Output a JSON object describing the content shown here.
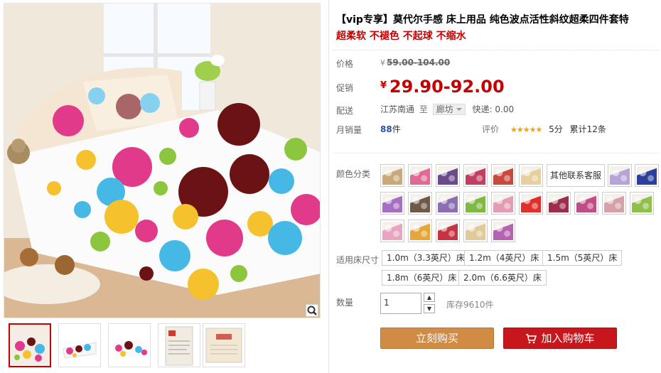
{
  "product": {
    "title": "【vip专享】莫代尔手感 床上用品 纯色波点活性斜纹超柔四件套特",
    "subtitle": "超柔软 不褪色 不起球 不缩水"
  },
  "price": {
    "label": "价格",
    "currency": "¥",
    "original": "59.00-104.00",
    "promo_label": "促销",
    "promo": "29.90-92.00"
  },
  "shipping": {
    "label": "配送",
    "from": "江苏南通",
    "to_word": "至",
    "to_city": "廊坊",
    "fee": "快递: 0.00"
  },
  "sales": {
    "label": "月销量",
    "count": "88",
    "unit": "件",
    "rating_label": "评价",
    "stars": "★★★★★",
    "score": "5分",
    "reviews": "累计12条"
  },
  "colors": {
    "label": "颜色分类",
    "text_option": "其他联系客服",
    "swatches": [
      "#c9a97a",
      "#e06a93",
      "#6b4a8c",
      "#c23f63",
      "#c74a3e",
      "#e8cf9e",
      "#b6a4d8",
      "#2c3f9b",
      "#a76fc2",
      "#6f5a4a",
      "#8c6fb3",
      "#7fb843",
      "#e49bb4",
      "#e0302b",
      "#9e2c4b",
      "#c14d86",
      "#d6a0a8",
      "#8fc14a",
      "#e7a5c2",
      "#e6a73a",
      "#c63444",
      "#e2c99a",
      "#b463b0"
    ]
  },
  "sizes": {
    "label": "适用床尺寸",
    "options": [
      "1.0m（3.3英尺）床",
      "1.2m（4英尺）床",
      "1.5m（5英尺）床",
      "1.8m（6英尺）床",
      "2.0m（6.6英尺）床"
    ]
  },
  "quantity": {
    "label": "数量",
    "value": "1",
    "stock": "库存9610件"
  },
  "actions": {
    "buy_now": "立刻购买",
    "add_to_cart": "加入购物车"
  },
  "thumbnails": [
    "bedding-main",
    "pillow-closeup",
    "bedding-side",
    "package-front",
    "package-back"
  ],
  "colors_theme": {
    "price_red": "#c40000",
    "buy_button": "#d08b45",
    "cart_button": "#c8161d",
    "link_blue": "#2953a6",
    "star": "#f3a20d"
  }
}
